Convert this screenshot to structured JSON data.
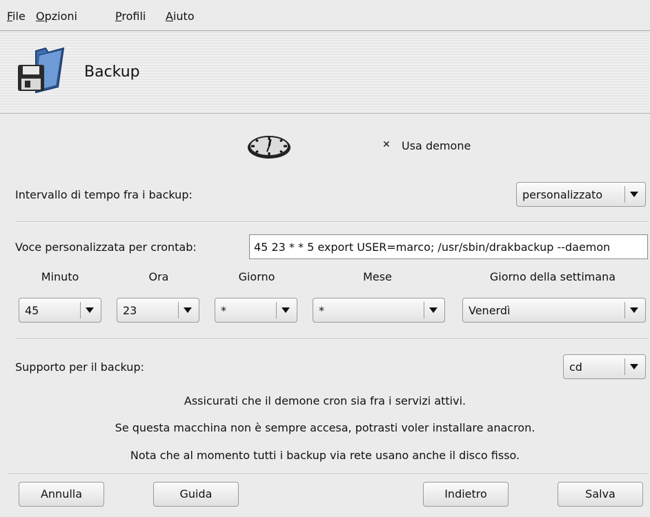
{
  "menubar": {
    "items": [
      {
        "label": "File",
        "mnemonic": "F",
        "rest": "ile"
      },
      {
        "label": "Opzioni",
        "mnemonic": "O",
        "rest": "pzioni"
      },
      {
        "label": "Profili",
        "mnemonic": "P",
        "rest": "rofili"
      },
      {
        "label": "Aiuto",
        "mnemonic": "A",
        "rest": "iuto"
      }
    ]
  },
  "header": {
    "title": "Backup",
    "icon": "backup-folder-floppy-icon"
  },
  "daemon": {
    "icon": "clock-icon",
    "checkbox_label": "Usa demone",
    "checked": true
  },
  "interval": {
    "label": "Intervallo di tempo fra i backup:",
    "value": "personalizzato"
  },
  "crontab": {
    "label": "Voce personalizzata per crontab:",
    "value": "45 23 * * 5 export USER=marco; /usr/sbin/drakbackup --daemon"
  },
  "schedule": {
    "columns": [
      "Minuto",
      "Ora",
      "Giorno",
      "Mese",
      "Giorno della settimana"
    ],
    "values": [
      "45",
      "23",
      "*",
      "*",
      "Venerdì"
    ]
  },
  "media": {
    "label": "Supporto per il backup:",
    "value": "cd"
  },
  "notes": [
    "Assicurati che il demone cron sia fra i servizi attivi.",
    "Se questa macchina non è sempre accesa, potrasti voler installare anacron.",
    "Nota che al momento tutti i backup via rete usano anche il disco fisso."
  ],
  "buttons": {
    "cancel": "Annulla",
    "help": "Guida",
    "back": "Indietro",
    "save": "Salva"
  }
}
